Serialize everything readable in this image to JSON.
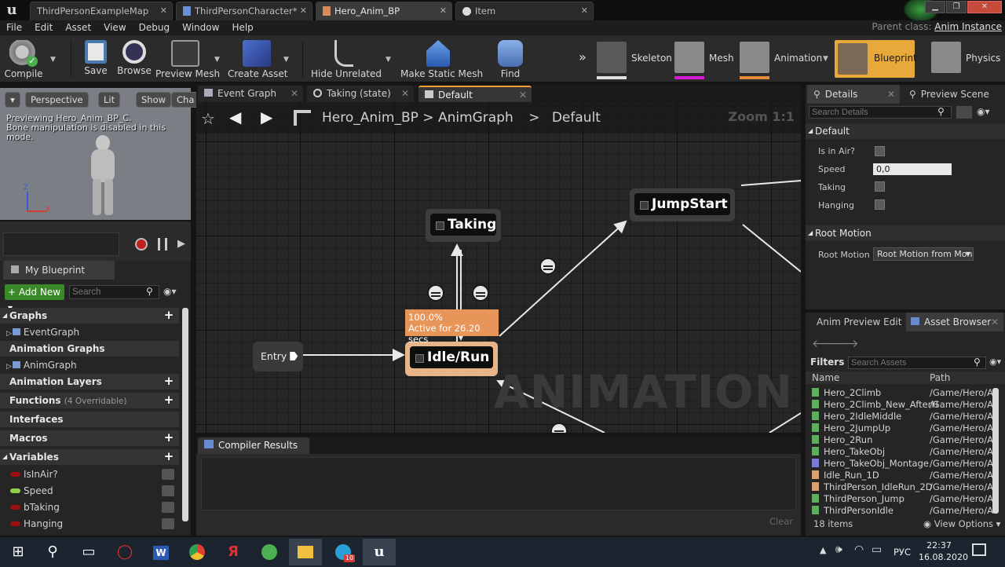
{
  "doc_tabs": [
    "ThirdPersonExampleMap",
    "ThirdPersonCharacter*",
    "Hero_Anim_BP",
    "Item"
  ],
  "menu": [
    "File",
    "Edit",
    "Asset",
    "View",
    "Debug",
    "Window",
    "Help"
  ],
  "parent_class": {
    "label": "Parent class:",
    "value": "Anim Instance"
  },
  "toolbar": {
    "compile": "Compile",
    "save": "Save",
    "browse": "Browse",
    "preview_mesh": "Preview Mesh",
    "create_asset": "Create Asset",
    "hide_unrelated": "Hide Unrelated",
    "make_static_mesh": "Make Static Mesh",
    "find": "Find"
  },
  "modes": [
    "Skeleton",
    "Mesh",
    "Animation",
    "Blueprint",
    "Physics"
  ],
  "viewport": {
    "buttons": [
      "Perspective",
      "Lit",
      "Show",
      "Cha"
    ],
    "line1": "Previewing Hero_Anim_BP_C.",
    "line2": "Bone manipulation is disabled in this mode."
  },
  "my_blueprint": {
    "tab": "My Blueprint",
    "add_new": "+ Add New",
    "search_placeholder": "Search",
    "sections": {
      "graphs": "Graphs",
      "animation_graphs": "Animation Graphs",
      "animation_layers": "Animation Layers",
      "functions": "Functions",
      "functions_note": "(4 Overridable)",
      "interfaces": "Interfaces",
      "macros": "Macros",
      "variables": "Variables"
    },
    "event_graph": "EventGraph",
    "anim_graph": "AnimGraph",
    "variables": [
      {
        "name": "IsInAir?",
        "color": "#9a1010"
      },
      {
        "name": "Speed",
        "color": "#8fd14a"
      },
      {
        "name": "bTaking",
        "color": "#9a1010"
      },
      {
        "name": "Hanging",
        "color": "#9a1010"
      }
    ]
  },
  "graph_tabs": [
    "Event Graph",
    "Taking (state)",
    "Default"
  ],
  "breadcrumb": {
    "root": "Hero_Anim_BP",
    "sep": ">",
    "mid": "AnimGraph",
    "leaf": "Default"
  },
  "zoom": "Zoom 1:1",
  "watermark": "ANIMATION",
  "nodes": {
    "taking": "Taking",
    "jumpstart": "JumpStart",
    "idle": "Idle/Run",
    "entry": "Entry"
  },
  "active_info": {
    "pct": "100.0%",
    "active": "Active for 26.20 secs"
  },
  "compiler": {
    "tab": "Compiler Results",
    "clear": "Clear"
  },
  "details": {
    "tabs": [
      "Details",
      "Preview Scene"
    ],
    "search_placeholder": "Search Details",
    "default_section": "Default",
    "props": {
      "in_air": "Is in Air?",
      "speed": "Speed",
      "speed_value": "0,0",
      "taking": "Taking",
      "hanging": "Hanging"
    },
    "root_motion_section": "Root Motion",
    "root_motion_label": "Root Motion M",
    "root_motion_value": "Root Motion from Mon"
  },
  "asset_browser": {
    "tabs": [
      "Anim Preview Edit",
      "Asset Browser"
    ],
    "filters": "Filters",
    "search_placeholder": "Search Assets",
    "col_name": "Name",
    "col_path": "Path",
    "rows": [
      {
        "name": "Hero_2Climb",
        "path": "/Game/Hero/A",
        "color": "#5fae5f"
      },
      {
        "name": "Hero_2Climb_New_AfterH",
        "path": "/Game/Hero/A",
        "color": "#5fae5f"
      },
      {
        "name": "Hero_2IdleMiddle",
        "path": "/Game/Hero/A",
        "color": "#5fae5f"
      },
      {
        "name": "Hero_2JumpUp",
        "path": "/Game/Hero/A",
        "color": "#5fae5f"
      },
      {
        "name": "Hero_2Run",
        "path": "/Game/Hero/A",
        "color": "#5fae5f"
      },
      {
        "name": "Hero_TakeObj",
        "path": "/Game/Hero/A",
        "color": "#5fae5f"
      },
      {
        "name": "Hero_TakeObj_Montage",
        "path": "/Game/Hero/A",
        "color": "#7b7bd6"
      },
      {
        "name": "Idle_Run_1D",
        "path": "/Game/Hero/A",
        "color": "#d9a070"
      },
      {
        "name": "ThirdPerson_IdleRun_2D",
        "path": "/Game/Hero/A",
        "color": "#d9a070"
      },
      {
        "name": "ThirdPerson_Jump",
        "path": "/Game/Hero/A",
        "color": "#5fae5f"
      },
      {
        "name": "ThirdPersonIdle",
        "path": "/Game/Hero/A",
        "color": "#5fae5f"
      }
    ],
    "count": "18 items",
    "view_options": "View Options"
  },
  "taskbar": {
    "lang": "РУС",
    "time": "22:37",
    "date": "16.08.2020",
    "badge": "10"
  }
}
